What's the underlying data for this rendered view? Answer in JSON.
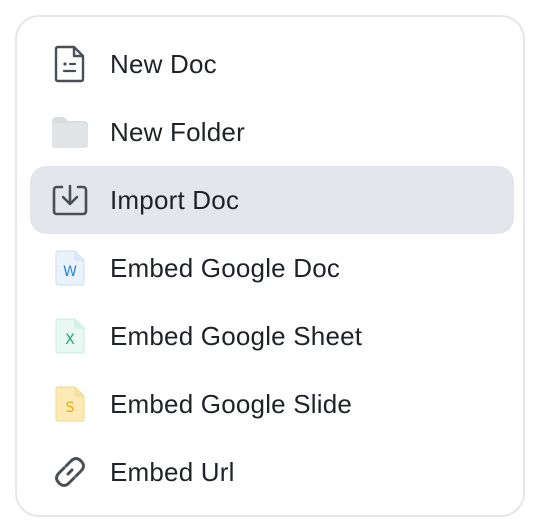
{
  "menu": {
    "items": [
      {
        "label": "New Doc",
        "icon": "document-icon",
        "active": false
      },
      {
        "label": "New Folder",
        "icon": "folder-icon",
        "active": false
      },
      {
        "label": "Import Doc",
        "icon": "import-icon",
        "active": true
      },
      {
        "label": "Embed Google Doc",
        "icon": "google-doc-icon",
        "active": false,
        "badge": "W",
        "color": "#2f80d8"
      },
      {
        "label": "Embed Google Sheet",
        "icon": "google-sheet-icon",
        "active": false,
        "badge": "X",
        "color": "#22a37a"
      },
      {
        "label": "Embed Google Slide",
        "icon": "google-slide-icon",
        "active": false,
        "badge": "S",
        "color": "#e8ad17"
      },
      {
        "label": "Embed Url",
        "icon": "link-icon",
        "active": false
      }
    ]
  },
  "colors": {
    "active_bg": "#e4e6ed",
    "text": "#1f2328",
    "icon_stroke": "#4a4f57"
  }
}
